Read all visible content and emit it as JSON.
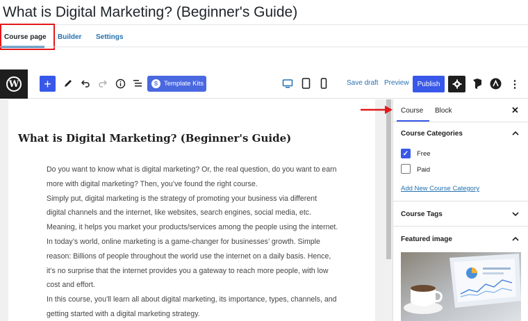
{
  "page": {
    "title": "What is Digital Marketing? (Beginner's Guide)"
  },
  "tabs": [
    {
      "label": "Course page"
    },
    {
      "label": "Builder"
    },
    {
      "label": "Settings"
    }
  ],
  "toolbar": {
    "add_icon": "plus-icon",
    "tools_icon": "pen-icon",
    "undo_icon": "undo-icon",
    "redo_icon": "redo-icon",
    "info_icon": "info-icon",
    "list_view_icon": "list-view-icon",
    "template_kits_label": "Template Kits",
    "save_draft_label": "Save draft",
    "preview_label": "Preview",
    "publish_label": "Publish",
    "settings_icon": "gear-icon"
  },
  "editor": {
    "post_title": "What is Digital Marketing? (Beginner's Guide)",
    "lines": [
      "Do you want to know what is digital marketing? Or, the real question, do you want to earn",
      "more with digital marketing? Then, you’ve found the right course.",
      "Simply put, digital marketing is the strategy of promoting your business via different",
      "digital channels and the internet, like websites, search engines, social media, etc.",
      "Meaning, it helps you market your products/services among the people using the internet.",
      "In today’s world, online marketing is a game-changer for businesses’ growth. Simple",
      "reason: Billions of people throughout the world use the internet on a daily basis. Hence,",
      "it’s no surprise that the internet provides you a gateway to reach more people, with low",
      "cost and effort.",
      "In this course, you’ll learn all about digital marketing, its importance, types, channels, and",
      "getting started with a digital marketing strategy."
    ]
  },
  "sidebar": {
    "tabs": [
      {
        "label": "Course"
      },
      {
        "label": "Block"
      }
    ],
    "close_icon": "close-icon",
    "categories": {
      "title": "Course Categories",
      "items": [
        {
          "label": "Free",
          "checked": true
        },
        {
          "label": "Paid",
          "checked": false
        }
      ],
      "add_link": "Add New Course Category"
    },
    "tags": {
      "title": "Course Tags"
    },
    "featured": {
      "title": "Featured image"
    }
  },
  "colors": {
    "accent": "#3858e9",
    "link": "#2271b1",
    "highlight_box": "#e3181a"
  }
}
